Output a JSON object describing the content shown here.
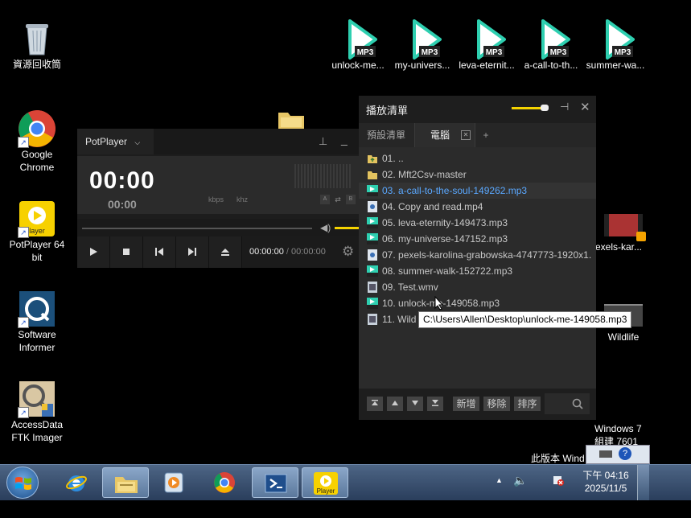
{
  "desktop_icons_left": [
    {
      "label": "資源回收筒",
      "icon": "recycle-bin-icon"
    },
    {
      "label": "Google\nChrome",
      "line1": "Google",
      "line2": "Chrome",
      "icon": "chrome-icon"
    },
    {
      "label": "PotPlayer 64 bit",
      "line1": "PotPlayer 64",
      "line2": "bit",
      "icon": "potplayer-icon"
    },
    {
      "label": "Software Informer",
      "line1": "Software",
      "line2": "Informer",
      "icon": "software-informer-icon"
    },
    {
      "label": "AccessData FTK Imager",
      "line1": "AccessData",
      "line2": "FTK Imager",
      "icon": "ftk-imager-icon"
    }
  ],
  "desktop_icons_top": [
    {
      "label": "unlock-me..."
    },
    {
      "label": "my-univers..."
    },
    {
      "label": "leva-eternit..."
    },
    {
      "label": "a-call-to-th..."
    },
    {
      "label": "summer-wa..."
    }
  ],
  "mp3_badge": "MP3",
  "desktop_icons_right": [
    {
      "label": "exels-kar..."
    },
    {
      "label": "Wildlife"
    }
  ],
  "watermark": {
    "line1": "Windows 7",
    "line2": "組建 7601",
    "line3": "此版本 Wind"
  },
  "player": {
    "title": "PotPlayer",
    "big_time": "00:00",
    "small_time": "00:00",
    "kbps": "kbps",
    "khz": "khz",
    "time_current": "00:00:00",
    "time_sep": "/",
    "time_total": "00:00:00",
    "mini_a": "A",
    "mini_b": "B"
  },
  "playlist": {
    "title": "播放清單",
    "tabs": [
      {
        "label": "預設清單",
        "active": false
      },
      {
        "label": "電腦",
        "active": true
      }
    ],
    "add_tab": "+",
    "items": [
      {
        "text": "01. ..",
        "type": "folder-up"
      },
      {
        "text": "02. Mft2Csv-master",
        "type": "folder"
      },
      {
        "text": "03. a-call-to-the-soul-149262.mp3",
        "type": "mp3",
        "selected": true
      },
      {
        "text": "04. Copy and read.mp4",
        "type": "video"
      },
      {
        "text": "05. leva-eternity-149473.mp3",
        "type": "mp3"
      },
      {
        "text": "06. my-universe-147152.mp3",
        "type": "mp3"
      },
      {
        "text": "07. pexels-karolina-grabowska-4747773-1920x1...",
        "type": "video"
      },
      {
        "text": "08. summer-walk-152722.mp3",
        "type": "mp3"
      },
      {
        "text": "09. Test.wmv",
        "type": "wmv"
      },
      {
        "text": "10. unlock-me-149058.mp3",
        "type": "mp3"
      },
      {
        "text": "11. Wild",
        "type": "wmv"
      }
    ],
    "footer_buttons": [
      "新增",
      "移除",
      "排序"
    ],
    "tooltip": "C:\\Users\\Allen\\Desktop\\unlock-me-149058.mp3"
  },
  "taskbar": {
    "time": "下午 04:16",
    "date": "2025/11/5",
    "pinned": [
      "windows-explorer-icon",
      "media-player-icon",
      "chrome-icon",
      "powershell-icon",
      "potplayer-icon"
    ],
    "potplayer_label": "Player"
  },
  "colors": {
    "accent_yellow": "#f5d300",
    "selected_text": "#5aa8ff",
    "mp3_green": "#2ecfb0"
  }
}
